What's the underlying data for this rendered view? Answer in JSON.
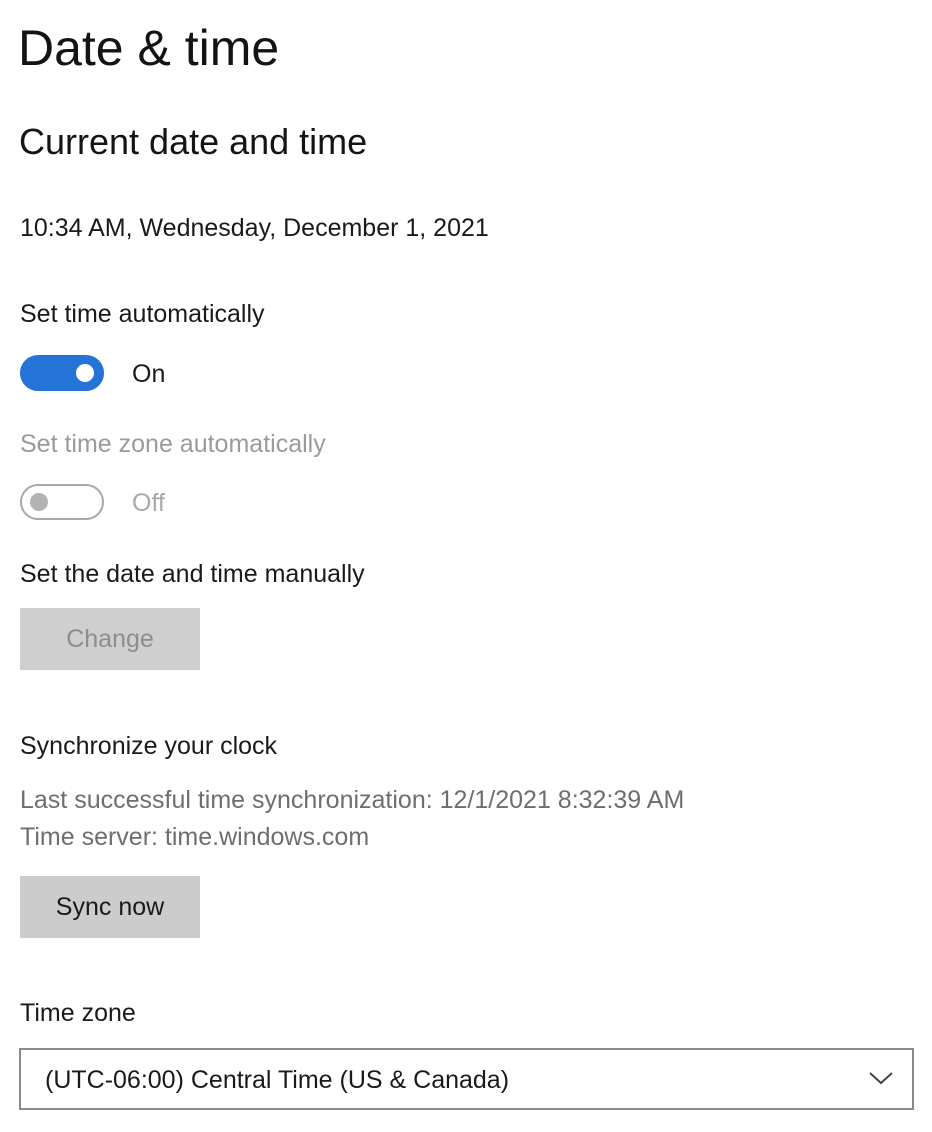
{
  "page": {
    "title": "Date & time"
  },
  "current": {
    "heading": "Current date and time",
    "datetime": "10:34 AM, Wednesday, December 1, 2021"
  },
  "set_time_auto": {
    "label": "Set time automatically",
    "state": "On",
    "enabled": true,
    "accent_color": "#2673d8"
  },
  "set_timezone_auto": {
    "label": "Set time zone automatically",
    "state": "Off",
    "enabled": false
  },
  "manual": {
    "label": "Set the date and time manually",
    "button_label": "Change",
    "button_enabled": false
  },
  "sync": {
    "heading": "Synchronize your clock",
    "last_sync": "Last successful time synchronization: 12/1/2021 8:32:39 AM",
    "time_server": "Time server: time.windows.com",
    "button_label": "Sync now"
  },
  "timezone": {
    "label": "Time zone",
    "selected": "(UTC-06:00) Central Time (US & Canada)",
    "icon": "chevron-down-icon"
  }
}
